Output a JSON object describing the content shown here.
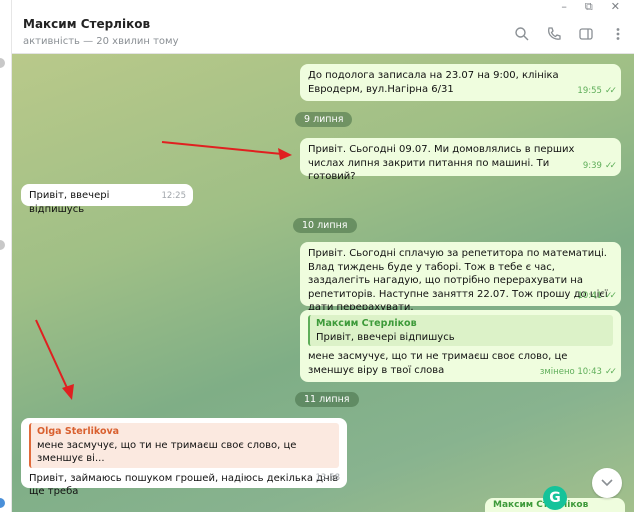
{
  "window": {
    "minimize": "–",
    "restore": "⧉",
    "close": "✕"
  },
  "header": {
    "title": "Максим Стерліков",
    "status": "активність — 20 хвилин тому"
  },
  "icons": [
    "search-icon",
    "phone-icon",
    "sidebar-toggle-icon",
    "more-vertical-icon"
  ],
  "messages": [
    {
      "text": "До подолога записала на 23.07 на 9:00, клініка Евродерм, вул.Нагірна 6/31",
      "time": "19:55"
    },
    {
      "date": "9 липня"
    },
    {
      "text": "Привіт. Сьогодні 09.07. Ми домовлялись в перших числах липня закрити питання по машині. Ти готовий?",
      "time": "9:39"
    },
    {
      "text": "Привіт, ввечері відпишусь",
      "time": "12:25"
    },
    {
      "date": "10 липня"
    },
    {
      "text": "Привіт. Сьогодні сплачую за репетитора по математиці. Влад тиждень буде у таборі. Тож в тебе є час, заздалегіть нагадую, що потрібно перерахувати на репетиторів. Наступне заняття 22.07. Тож прошу до цієї дати перерахувати.",
      "time": "10:41"
    },
    {
      "quote_name": "Максим Стерліков",
      "quote_text": "Привіт, ввечері відпишусь",
      "text": "мене засмучує, що ти не тримаєш своє слово, це зменшує віру в твої слова",
      "time": "змінено 10:43"
    },
    {
      "date": "11 липня"
    },
    {
      "quote_name": "Olga Sterlikova",
      "quote_text": "мене засмучує, що ти не тримаєш своє слово, це зменшує ві...",
      "text": "Привіт, займаюсь пошуком грошей, надіюсь декілька днів ще треба",
      "time": "13:58"
    }
  ],
  "bottom_peek": "Максим Стерліков",
  "grammarly": "G",
  "colors": {
    "outgoing": "#effdde",
    "accent": "#5fae5a",
    "arrow": "#e02020"
  }
}
